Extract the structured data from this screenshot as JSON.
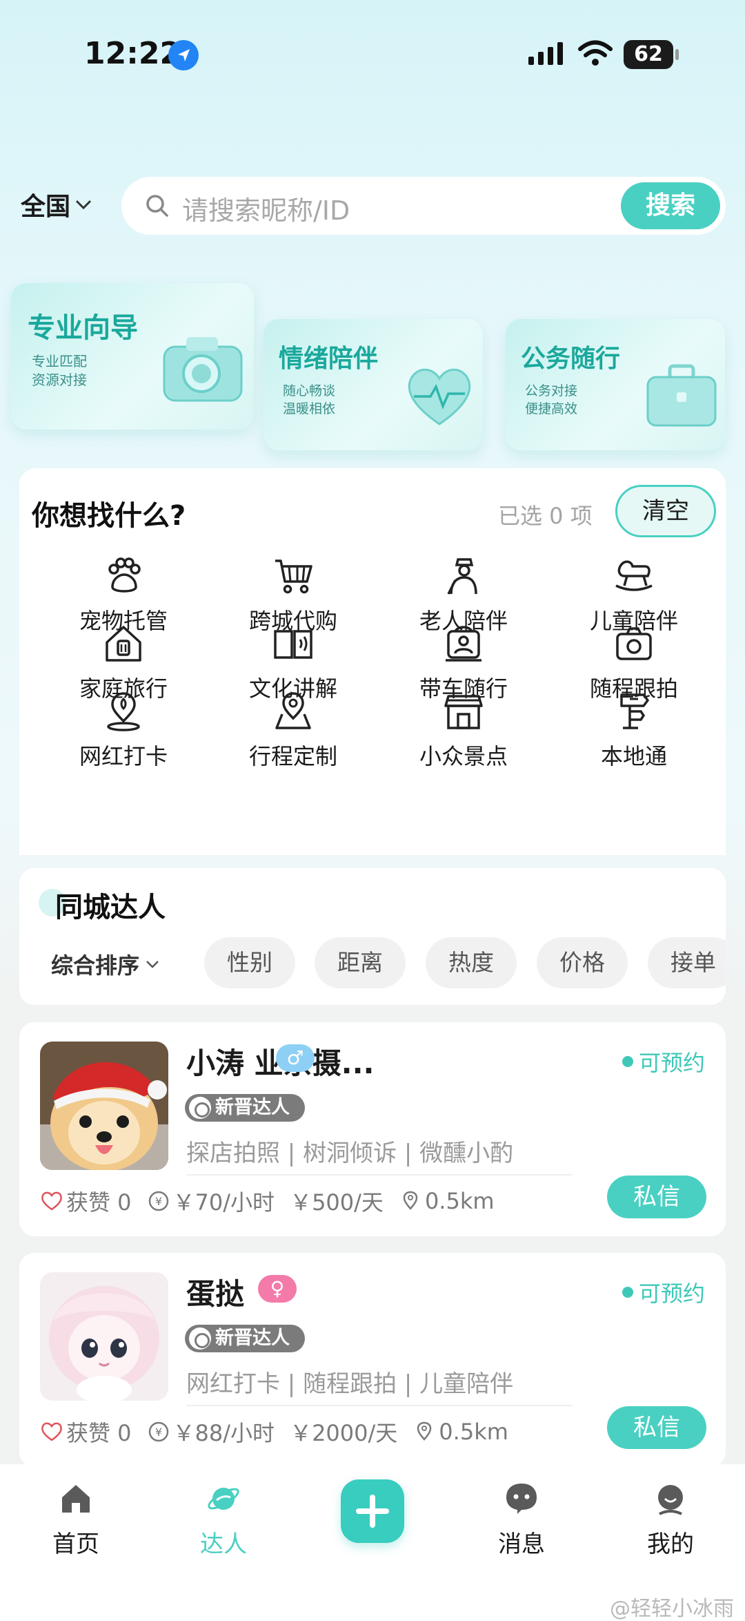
{
  "status_bar": {
    "time": "12:22",
    "battery": "62"
  },
  "search": {
    "region": "全国",
    "placeholder": "请搜索昵称/ID",
    "button": "搜索"
  },
  "promos": [
    {
      "title": "专业向导",
      "lines": [
        "专业匹配",
        "资源对接"
      ],
      "icon": "camera-icon"
    },
    {
      "title": "情绪陪伴",
      "lines": [
        "随心畅谈",
        "温暖相依"
      ],
      "icon": "heart-icon"
    },
    {
      "title": "公务随行",
      "lines": [
        "公务对接",
        "便捷高效"
      ],
      "icon": "briefcase-icon"
    }
  ],
  "want": {
    "title": "你想找什么?",
    "selected": "已选 0 项",
    "clear": "清空",
    "categories": [
      {
        "label": "宠物托管",
        "icon": "paw-icon"
      },
      {
        "label": "跨城代购",
        "icon": "cart-icon"
      },
      {
        "label": "老人陪伴",
        "icon": "elder-icon"
      },
      {
        "label": "儿童陪伴",
        "icon": "rocking-horse-icon"
      },
      {
        "label": "家庭旅行",
        "icon": "house-icon"
      },
      {
        "label": "文化讲解",
        "icon": "book-icon"
      },
      {
        "label": "带车随行",
        "icon": "driver-icon"
      },
      {
        "label": "随程跟拍",
        "icon": "camera-icon"
      },
      {
        "label": "网红打卡",
        "icon": "pin-icon"
      },
      {
        "label": "行程定制",
        "icon": "map-pin-icon"
      },
      {
        "label": "小众景点",
        "icon": "shop-icon"
      },
      {
        "label": "本地通",
        "icon": "signpost-icon"
      }
    ]
  },
  "local": {
    "title": "同城达人",
    "sort": "综合排序",
    "filters": [
      "性别",
      "距离",
      "热度",
      "价格",
      "接单"
    ]
  },
  "experts": [
    {
      "name": "小涛 业余摄...",
      "gender": "♂",
      "status": "可预约",
      "badge": "新晋达人",
      "tags": "探店拍照 | 树洞倾诉 | 微醺小酌",
      "likes": "获赞 0",
      "hour_price": "￥70/小时",
      "day_price": "￥500/天",
      "distance": "0.5km",
      "button": "私信"
    },
    {
      "name": "蛋挞",
      "gender": "♀",
      "status": "可预约",
      "badge": "新晋达人",
      "tags": "网红打卡 | 随程跟拍 | 儿童陪伴",
      "likes": "获赞 0",
      "hour_price": "￥88/小时",
      "day_price": "￥2000/天",
      "distance": "0.5km",
      "button": "私信"
    }
  ],
  "nav": [
    {
      "label": "首页",
      "icon": "home-icon"
    },
    {
      "label": "达人",
      "icon": "planet-icon"
    },
    {
      "label": "",
      "icon": "plus-icon"
    },
    {
      "label": "消息",
      "icon": "chat-icon"
    },
    {
      "label": "我的",
      "icon": "user-icon"
    }
  ],
  "watermark": "@轻轻小冰雨",
  "colors": {
    "accent": "#49d0c2",
    "promo_title": "#1aa89c",
    "badge": "#7b7b7b"
  }
}
